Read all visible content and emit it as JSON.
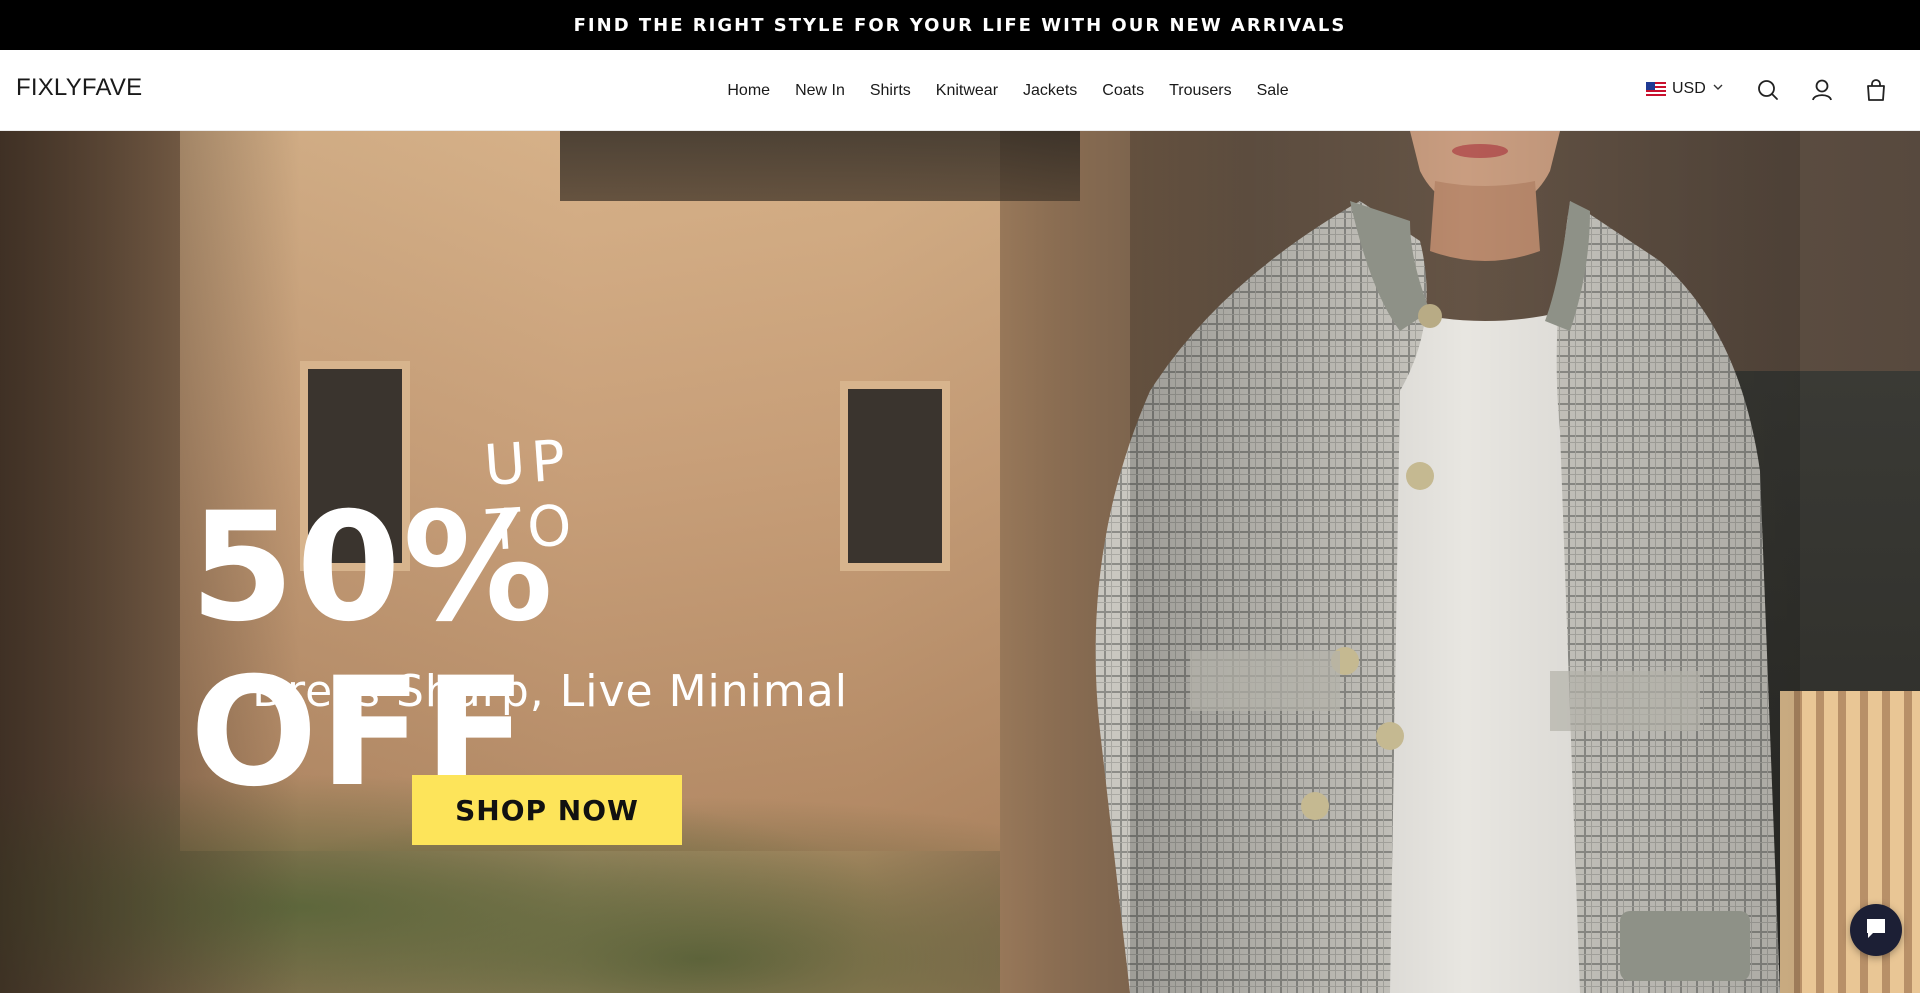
{
  "announcement": {
    "text": "FIND THE RIGHT STYLE FOR YOUR LIFE WITH OUR NEW ARRIVALS"
  },
  "header": {
    "logo": "FIXLYFAVE",
    "nav": [
      {
        "label": "Home"
      },
      {
        "label": "New In"
      },
      {
        "label": "Shirts"
      },
      {
        "label": "Knitwear"
      },
      {
        "label": "Jackets"
      },
      {
        "label": "Coats"
      },
      {
        "label": "Trousers"
      },
      {
        "label": "Sale"
      }
    ],
    "currency": {
      "code": "USD",
      "flag": "us-flag-icon"
    },
    "icons": [
      "search-icon",
      "account-icon",
      "cart-icon"
    ]
  },
  "hero": {
    "kicker": "UP TO",
    "headline": "50% OFF",
    "subheadline": "Dress Sharp, Live Minimal",
    "cta_label": "SHOP NOW",
    "cta_color": "#fde45a"
  },
  "chat": {
    "icon": "chat-bubble-icon",
    "color": "#1c1f35"
  }
}
